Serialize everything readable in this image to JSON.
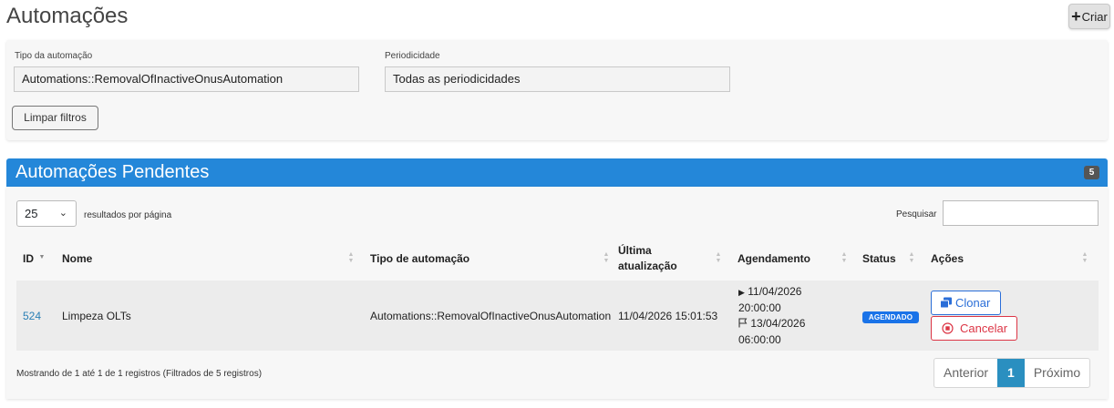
{
  "page": {
    "title": "Automações",
    "create_label": "Criar"
  },
  "filters": {
    "type_label": "Tipo da automação",
    "type_value": "Automations::RemovalOfInactiveOnusAutomation",
    "period_label": "Periodicidade",
    "period_value": "Todas as periodicidades",
    "clear_label": "Limpar filtros"
  },
  "panel": {
    "title": "Automações Pendentes",
    "count": "5"
  },
  "table_controls": {
    "page_size": "25",
    "per_page_label": "resultados por página",
    "search_label": "Pesquisar"
  },
  "columns": {
    "id": "ID",
    "nome": "Nome",
    "tipo": "Tipo de automação",
    "ultima_1": "Última",
    "ultima_2": "atualização",
    "agendamento": "Agendamento",
    "status": "Status",
    "acoes": "Ações"
  },
  "rows": [
    {
      "id": "524",
      "nome": "Limpeza OLTs",
      "tipo": "Automations::RemovalOfInactiveOnusAutomation",
      "atualizacao": "11/04/2026 15:01:53",
      "start_date": "11/04/2026",
      "start_time": "20:00:00",
      "end_date": "13/04/2026",
      "end_time": "06:00:00",
      "status": "AGENDADO",
      "clone_label": "Clonar",
      "cancel_label": "Cancelar"
    }
  ],
  "footer": {
    "info": "Mostrando de 1 até 1 de 1 registros (Filtrados de 5 registros)",
    "prev": "Anterior",
    "current": "1",
    "next": "Próximo"
  },
  "colors": {
    "header_blue": "#2487d9",
    "status_blue": "#1a73e8",
    "cancel_red": "#dc3545",
    "link_blue": "#2a7fb5"
  }
}
